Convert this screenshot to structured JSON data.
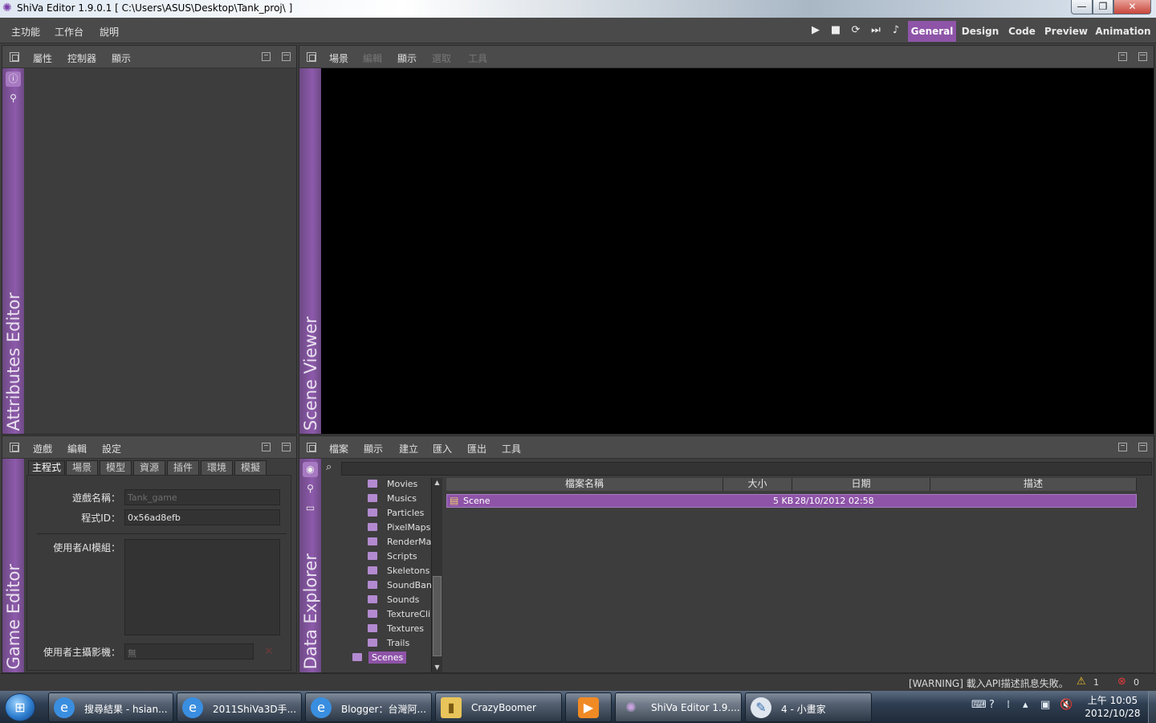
{
  "window": {
    "title": "ShiVa Editor 1.9.0.1 [ C:\\Users\\ASUS\\Desktop\\Tank_proj\\ ]",
    "min_glyph": "—",
    "max_glyph": "❐",
    "close_glyph": "✕"
  },
  "menubar": {
    "items": [
      "主功能",
      "工作台",
      "說明"
    ],
    "playback": {
      "play": "▶",
      "stop": "■",
      "restart": "⟳",
      "step": "⏭",
      "audio": "♪"
    },
    "modes": [
      {
        "label": "General",
        "active": true
      },
      {
        "label": "Design",
        "active": false
      },
      {
        "label": "Code",
        "active": false
      },
      {
        "label": "Preview",
        "active": false
      },
      {
        "label": "Animation",
        "active": false
      }
    ]
  },
  "attributes_panel": {
    "menus": [
      "屬性",
      "控制器",
      "顯示"
    ],
    "side_label": "Attributes Editor"
  },
  "scene_viewer": {
    "menus": [
      {
        "label": "場景",
        "enabled": true
      },
      {
        "label": "編輯",
        "enabled": false
      },
      {
        "label": "顯示",
        "enabled": true
      },
      {
        "label": "選取",
        "enabled": false
      },
      {
        "label": "工具",
        "enabled": false
      }
    ],
    "side_label": "Scene Viewer"
  },
  "game_editor": {
    "menus": [
      "遊戲",
      "編輯",
      "設定"
    ],
    "side_label": "Game Editor",
    "tabs": [
      {
        "label": "主程式",
        "active": true
      },
      {
        "label": "場景",
        "active": false
      },
      {
        "label": "模型",
        "active": false
      },
      {
        "label": "資源",
        "active": false
      },
      {
        "label": "插件",
        "active": false
      },
      {
        "label": "環境",
        "active": false
      },
      {
        "label": "模擬",
        "active": false
      }
    ],
    "fields": {
      "game_name_label": "遊戲名稱：",
      "game_name_value": "Tank_game",
      "program_id_label": "程式ID：",
      "program_id_value": "0x56ad8efb",
      "user_ai_label": "使用者AI模組：",
      "user_camera_label": "使用者主攝影機：",
      "user_camera_value": "無",
      "clear_glyph": "✕"
    }
  },
  "data_explorer": {
    "menus": [
      "檔案",
      "顯示",
      "建立",
      "匯入",
      "匯出",
      "工具"
    ],
    "side_label": "Data Explorer",
    "search_glyph": "⌕",
    "tree": [
      {
        "label": "Movies",
        "selected": false
      },
      {
        "label": "Musics",
        "selected": false
      },
      {
        "label": "Particles",
        "selected": false
      },
      {
        "label": "PixelMaps",
        "selected": false
      },
      {
        "label": "RenderMap",
        "selected": false
      },
      {
        "label": "Scripts",
        "selected": false
      },
      {
        "label": "Skeletons",
        "selected": false
      },
      {
        "label": "SoundBank",
        "selected": false
      },
      {
        "label": "Sounds",
        "selected": false
      },
      {
        "label": "TextureClip",
        "selected": false
      },
      {
        "label": "Textures",
        "selected": false
      },
      {
        "label": "Trails",
        "selected": false
      },
      {
        "label": "Scenes",
        "selected": true
      }
    ],
    "columns": [
      "檔案名稱",
      "大小",
      "日期",
      "描述"
    ],
    "rows": [
      {
        "name": "Scene",
        "size": "5 KB",
        "date": "28/10/2012 02:58",
        "desc": ""
      }
    ]
  },
  "statusbar": {
    "message": "[WARNING] 載入API描述訊息失敗。",
    "warning_count": "1",
    "error_count": "0"
  },
  "taskbar": {
    "start_glyph": "⊞",
    "tasks": [
      {
        "label": "搜尋結果 - hsian...",
        "icon": "ie-icon"
      },
      {
        "label": "2011ShiVa3D手...",
        "icon": "ie-icon"
      },
      {
        "label": "Blogger：台灣阿...",
        "icon": "ie-icon"
      },
      {
        "label": "CrazyBoomer",
        "icon": "folder-icon"
      },
      {
        "label": "",
        "icon": "media-player-icon"
      },
      {
        "label": "ShiVa Editor 1.9....",
        "icon": "shiva-icon"
      },
      {
        "label": "4 - 小畫家",
        "icon": "paint-icon"
      }
    ],
    "clock_time": "上午 10:05",
    "clock_date": "2012/10/28"
  },
  "colors": {
    "accent": "#8e54a8",
    "panel_bg": "#3d3d3d",
    "viewer_bg": "#000000"
  }
}
